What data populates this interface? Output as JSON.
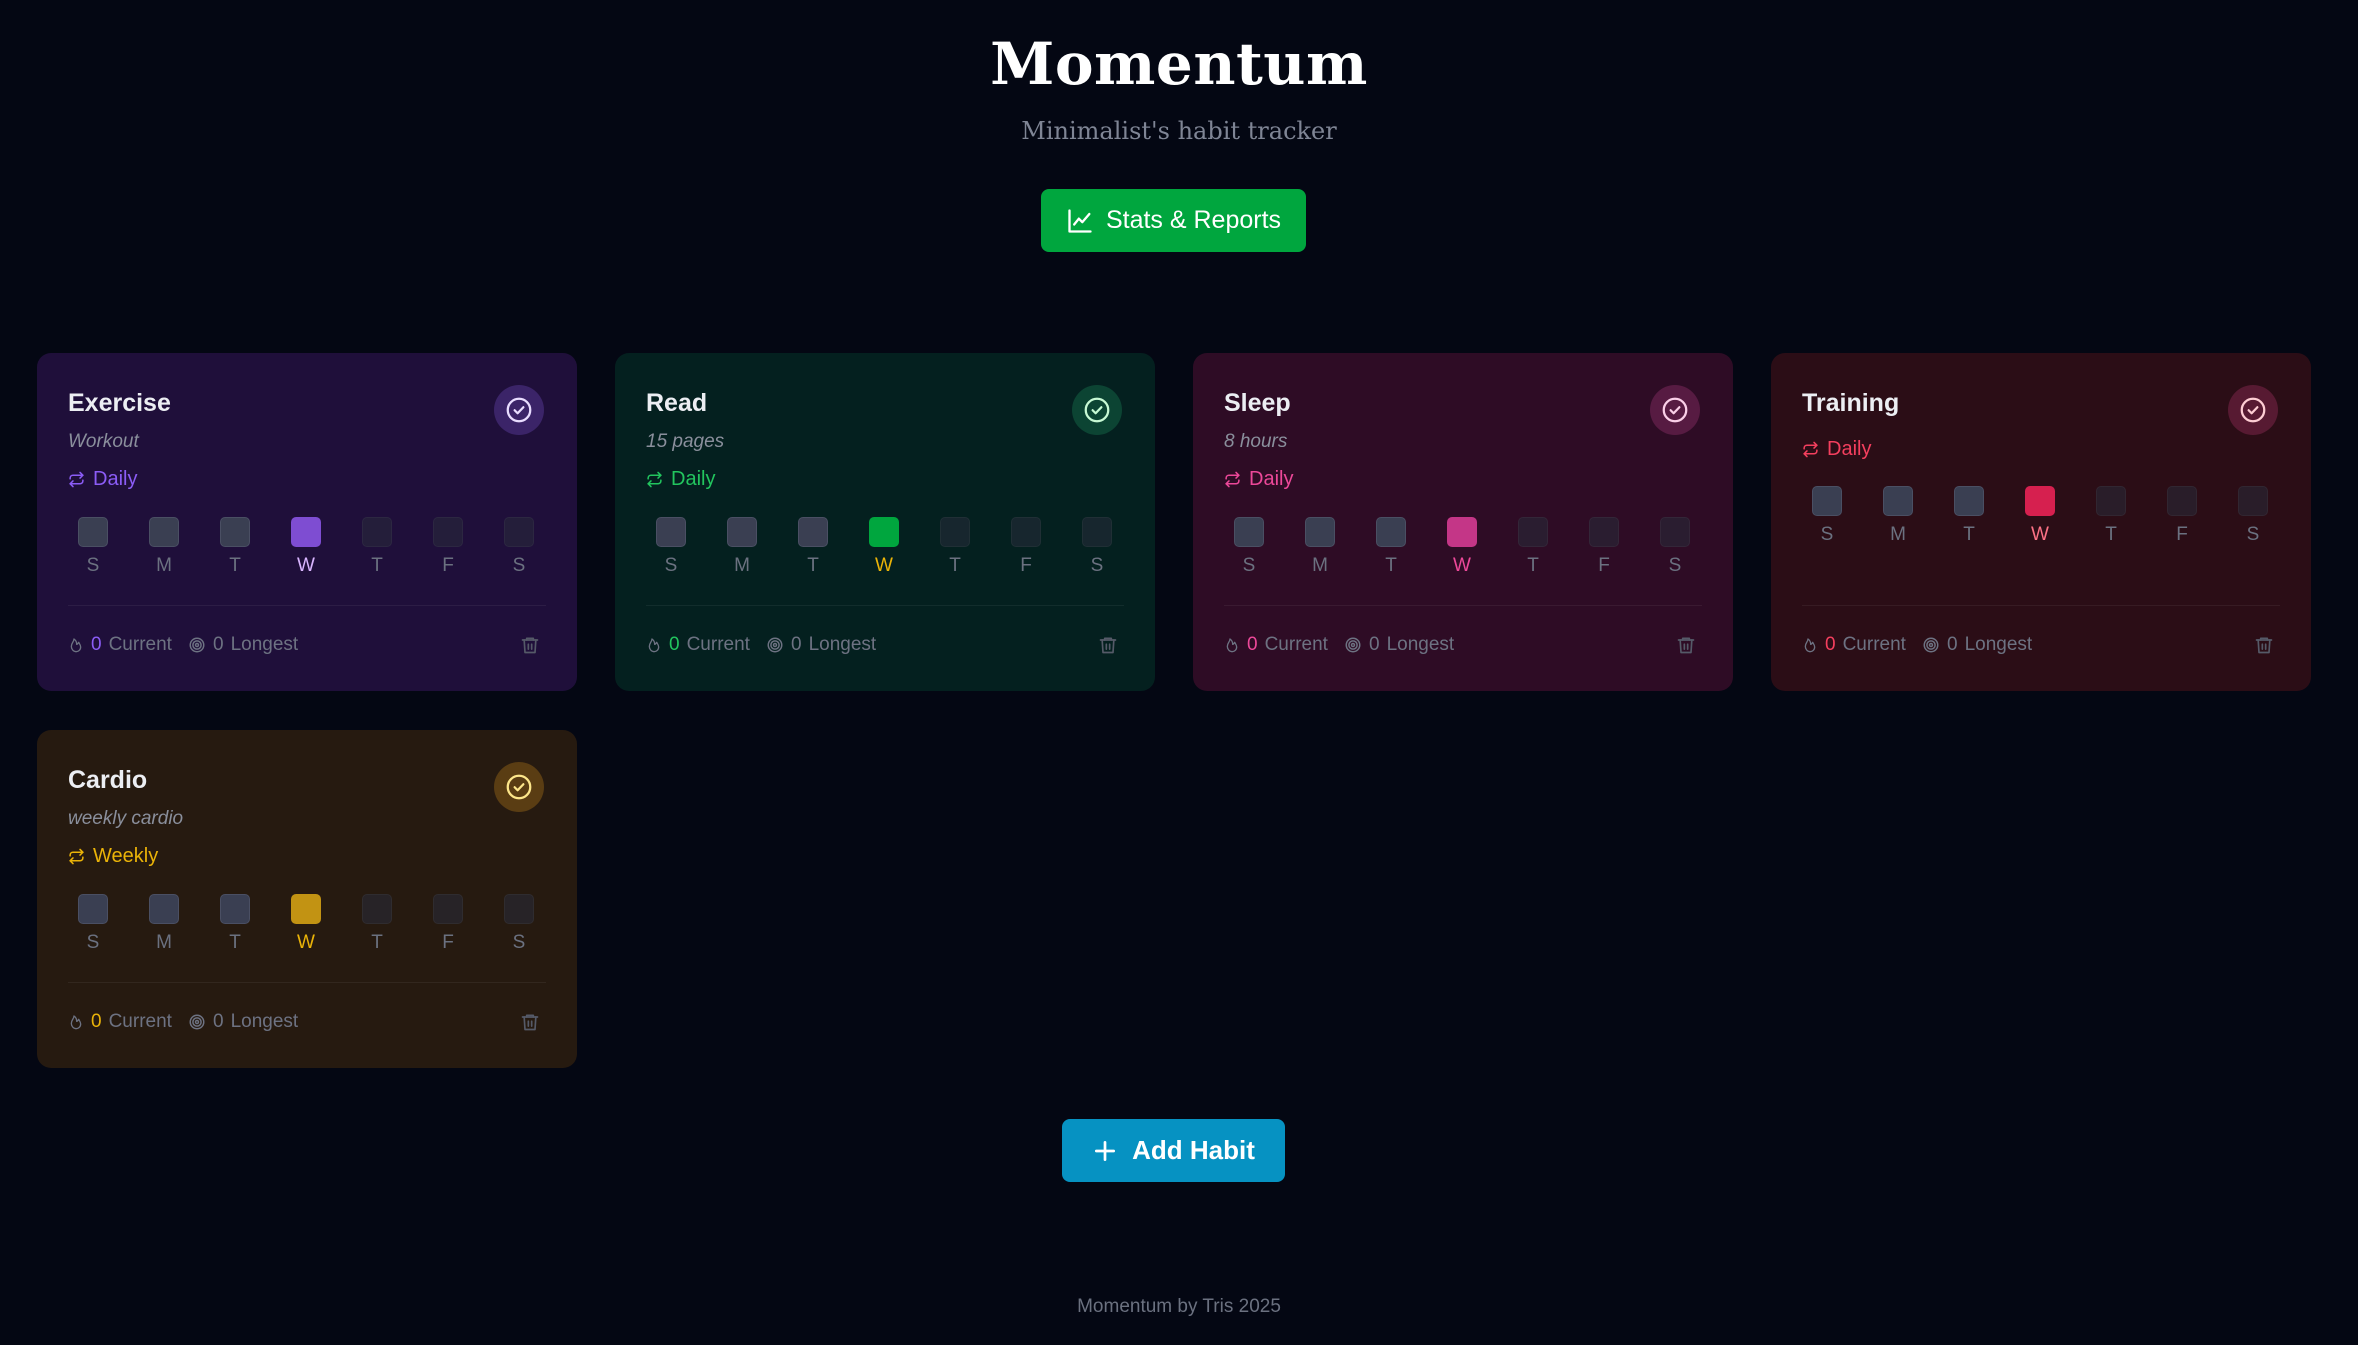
{
  "app": {
    "title": "Momentum",
    "subtitle": "Minimalist's habit tracker",
    "stats_button_label": "Stats & Reports",
    "add_button_label": "Add Habit",
    "footer": "Momentum by Tris 2025"
  },
  "day_letters": [
    "S",
    "M",
    "T",
    "W",
    "T",
    "F",
    "S"
  ],
  "current_day_index": 3,
  "stat_labels": {
    "current": "Current",
    "longest": "Longest"
  },
  "habits": [
    {
      "name": "Exercise",
      "description": "Workout",
      "frequency": "Daily",
      "current_streak": "0",
      "longest_streak": "0",
      "colors": {
        "card_bg": "#1f0f3a",
        "accent": "#8b5cf6",
        "check_bg": "#3b2468",
        "check_icon": "#e9ddff",
        "today_box": "#7e4dd2",
        "today_letter": "#d8b4fe"
      }
    },
    {
      "name": "Read",
      "description": "15 pages",
      "frequency": "Daily",
      "current_streak": "0",
      "longest_streak": "0",
      "colors": {
        "card_bg": "#04201f",
        "accent": "#22c55e",
        "check_bg": "#0c4433",
        "check_icon": "#c7f9d4",
        "today_box": "#00a63e",
        "today_letter": "#eab308"
      }
    },
    {
      "name": "Sleep",
      "description": "8 hours",
      "frequency": "Daily",
      "current_streak": "0",
      "longest_streak": "0",
      "colors": {
        "card_bg": "#2e0c25",
        "accent": "#ec4899",
        "check_bg": "#571b42",
        "check_icon": "#fbcfe8",
        "today_box": "#c43687",
        "today_letter": "#ec4899"
      }
    },
    {
      "name": "Training",
      "description": "",
      "frequency": "Daily",
      "current_streak": "0",
      "longest_streak": "0",
      "colors": {
        "card_bg": "#2b0d16",
        "accent": "#f43f5e",
        "check_bg": "#571a32",
        "check_icon": "#fecdd3",
        "today_box": "#d6204f",
        "today_letter": "#fb7185"
      }
    },
    {
      "name": "Cardio",
      "description": "weekly cardio",
      "frequency": "Weekly",
      "current_streak": "0",
      "longest_streak": "0",
      "colors": {
        "card_bg": "#261a10",
        "accent": "#eab308",
        "check_bg": "#5a3d13",
        "check_icon": "#fde68a",
        "today_box": "#c29313",
        "today_letter": "#eab308"
      }
    }
  ]
}
